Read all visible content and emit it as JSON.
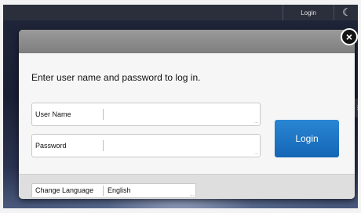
{
  "topbar": {
    "login_label": "Login",
    "moon_glyph": "☾",
    "side_glyph": "⠿"
  },
  "dialog": {
    "close_glyph": "×",
    "prompt": "Enter user name and password to log in.",
    "username": {
      "label": "User Name",
      "value": ""
    },
    "password": {
      "label": "Password",
      "value": ""
    },
    "login_button": "Login",
    "language": {
      "label": "Change Language",
      "value": "English"
    },
    "corner_glyph": "..."
  },
  "colors": {
    "accent": "#1a73c8",
    "header": "#8a8a8a"
  },
  "icons": [
    "moon-icon",
    "close-icon",
    "grid-handle-icon"
  ]
}
